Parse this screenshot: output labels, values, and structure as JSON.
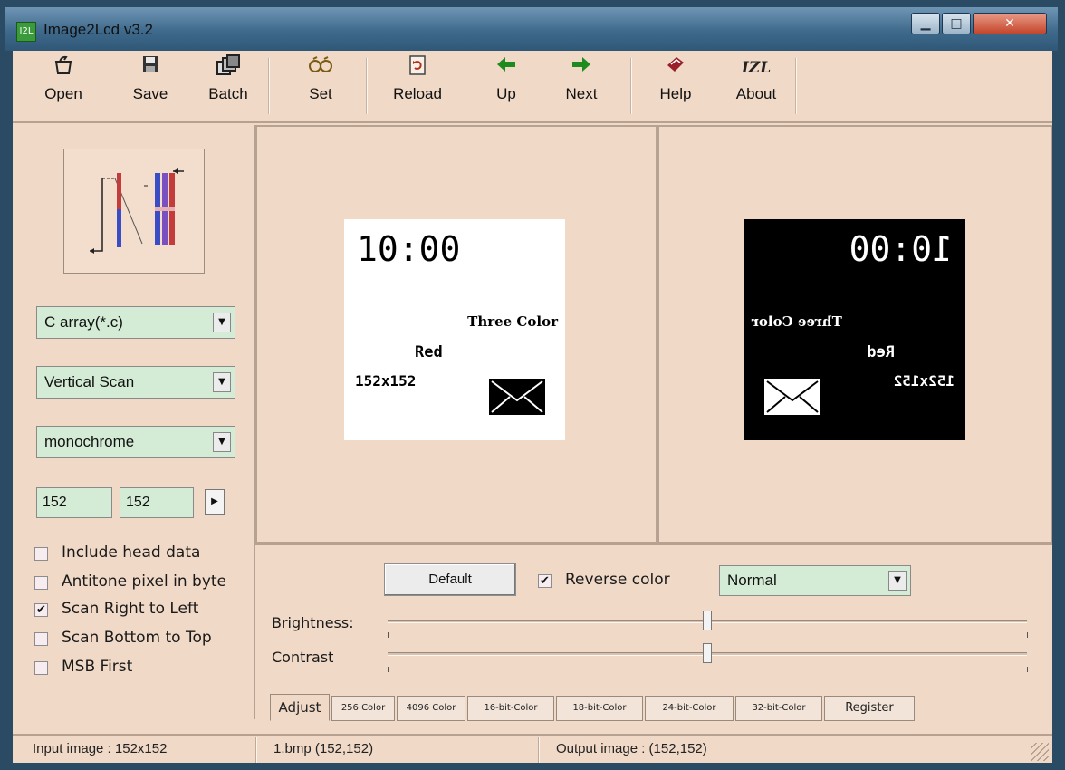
{
  "window": {
    "title": "Image2Lcd v3.2",
    "icon_text": "I2L"
  },
  "toolbar": {
    "items": [
      {
        "label": "Open",
        "icon": "open-icon"
      },
      {
        "label": "Save",
        "icon": "save-icon"
      },
      {
        "label": "Batch",
        "icon": "batch-icon"
      },
      {
        "label": "Set",
        "icon": "glasses-icon"
      },
      {
        "label": "Reload",
        "icon": "reload-icon"
      },
      {
        "label": "Up",
        "icon": "arrow-left-icon"
      },
      {
        "label": "Next",
        "icon": "arrow-right-icon"
      },
      {
        "label": "Help",
        "icon": "help-book-icon"
      },
      {
        "label": "About",
        "icon": "izl-logo-icon",
        "icon_text": "IZL"
      }
    ]
  },
  "left": {
    "output_type": "C array(*.c)",
    "scan_mode": "Vertical Scan",
    "color_mode": "monochrome",
    "width": "152",
    "height": "152",
    "options": [
      {
        "label": "Include head data",
        "checked": false
      },
      {
        "label": "Antitone pixel in byte",
        "checked": false
      },
      {
        "label": "Scan Right to Left",
        "checked": true
      },
      {
        "label": "Scan Bottom to Top",
        "checked": false
      },
      {
        "label": "MSB First",
        "checked": false
      }
    ]
  },
  "preview": {
    "time": "10:00",
    "line1": "Three Color",
    "line2": "Red",
    "line3": "152x152"
  },
  "adjust": {
    "default_label": "Default",
    "reverse_label": "Reverse color",
    "reverse_checked": true,
    "mode": "Normal",
    "brightness_label": "Brightness:",
    "contrast_label": "Contrast",
    "brightness_level": 0.5,
    "contrast_level": 0.5,
    "tabs": [
      "Adjust",
      "256 Color",
      "4096 Color",
      "16-bit-Color",
      "18-bit-Color",
      "24-bit-Color",
      "32-bit-Color",
      "Register"
    ]
  },
  "status": {
    "input": "Input image : 152x152",
    "file": "1.bmp  (152,152)",
    "output": "Output image :  (152,152)"
  },
  "colors": {
    "panel": "#f0d9c7",
    "field": "#d4ecd6",
    "titlebar": "#3f6a8c"
  }
}
